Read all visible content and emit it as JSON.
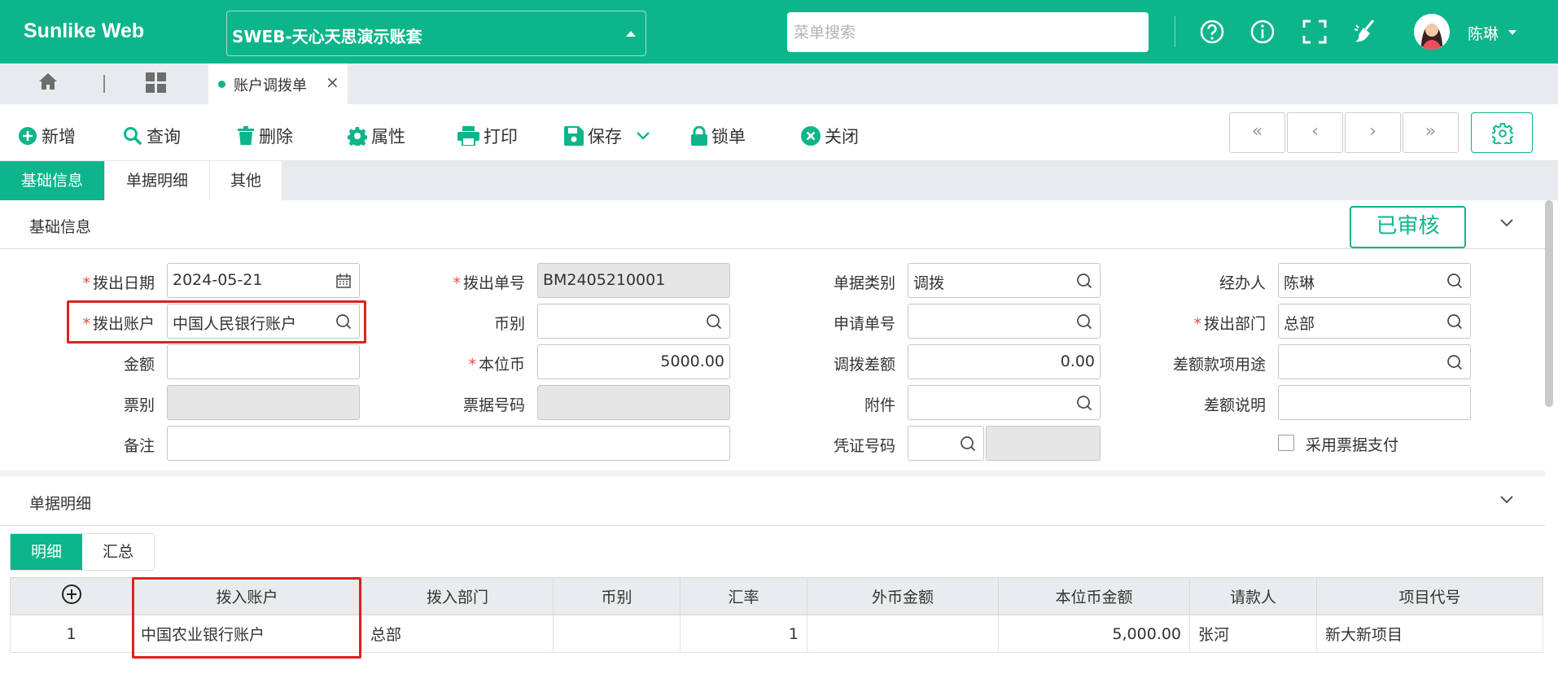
{
  "header": {
    "brand": "Sunlike Web",
    "account": "SWEB-天心天思演示账套",
    "search_placeholder": "菜单搜索",
    "user": "陈琳"
  },
  "tabs": {
    "doc_tab": "账户调拨单"
  },
  "toolbar": {
    "add": "新增",
    "query": "查询",
    "delete": "删除",
    "props": "属性",
    "print": "打印",
    "save": "保存",
    "lock": "锁单",
    "close": "关闭",
    "nav": [
      "«",
      "‹",
      "›",
      "»"
    ]
  },
  "form_tabs": [
    "基础信息",
    "单据明细",
    "其他"
  ],
  "basic": {
    "section_title": "基础信息",
    "status": "已审核",
    "fields": {
      "out_date": {
        "label": "拨出日期",
        "value": "2024-05-21"
      },
      "out_no": {
        "label": "拨出单号",
        "value": "BM2405210001"
      },
      "doc_type": {
        "label": "单据类别",
        "value": "调拨"
      },
      "handler": {
        "label": "经办人",
        "value": "陈琳"
      },
      "out_account": {
        "label": "拨出账户",
        "value": "中国人民银行账户"
      },
      "currency": {
        "label": "币别",
        "value": ""
      },
      "apply_no": {
        "label": "申请单号",
        "value": ""
      },
      "out_dept": {
        "label": "拨出部门",
        "value": "总部"
      },
      "amount": {
        "label": "金额",
        "value": ""
      },
      "local_currency": {
        "label": "本位币",
        "value": "5000.00"
      },
      "diff": {
        "label": "调拨差额",
        "value": "0.00"
      },
      "diff_use": {
        "label": "差额款项用途",
        "value": ""
      },
      "bill_type": {
        "label": "票别",
        "value": ""
      },
      "bill_no": {
        "label": "票据号码",
        "value": ""
      },
      "attach": {
        "label": "附件",
        "value": ""
      },
      "diff_note": {
        "label": "差额说明",
        "value": ""
      },
      "remark": {
        "label": "备注",
        "value": ""
      },
      "voucher": {
        "label": "凭证号码",
        "value": ""
      },
      "use_bill_pay": {
        "label": "采用票据支付",
        "checked": false
      }
    }
  },
  "detail": {
    "section_title": "单据明细",
    "subtabs": [
      "明细",
      "汇总"
    ],
    "columns": [
      "拨入账户",
      "拨入部门",
      "币别",
      "汇率",
      "外币金额",
      "本位币金额",
      "请款人",
      "项目代号"
    ],
    "rows": [
      {
        "no": "1",
        "in_account": "中国农业银行账户",
        "in_dept": "总部",
        "currency": "",
        "rate": "1",
        "fx_amount": "",
        "local_amount": "5,000.00",
        "requester": "张河",
        "project": "新大新项目"
      }
    ]
  },
  "colors": {
    "primary": "#0db58b",
    "highlight": "#e02020"
  }
}
